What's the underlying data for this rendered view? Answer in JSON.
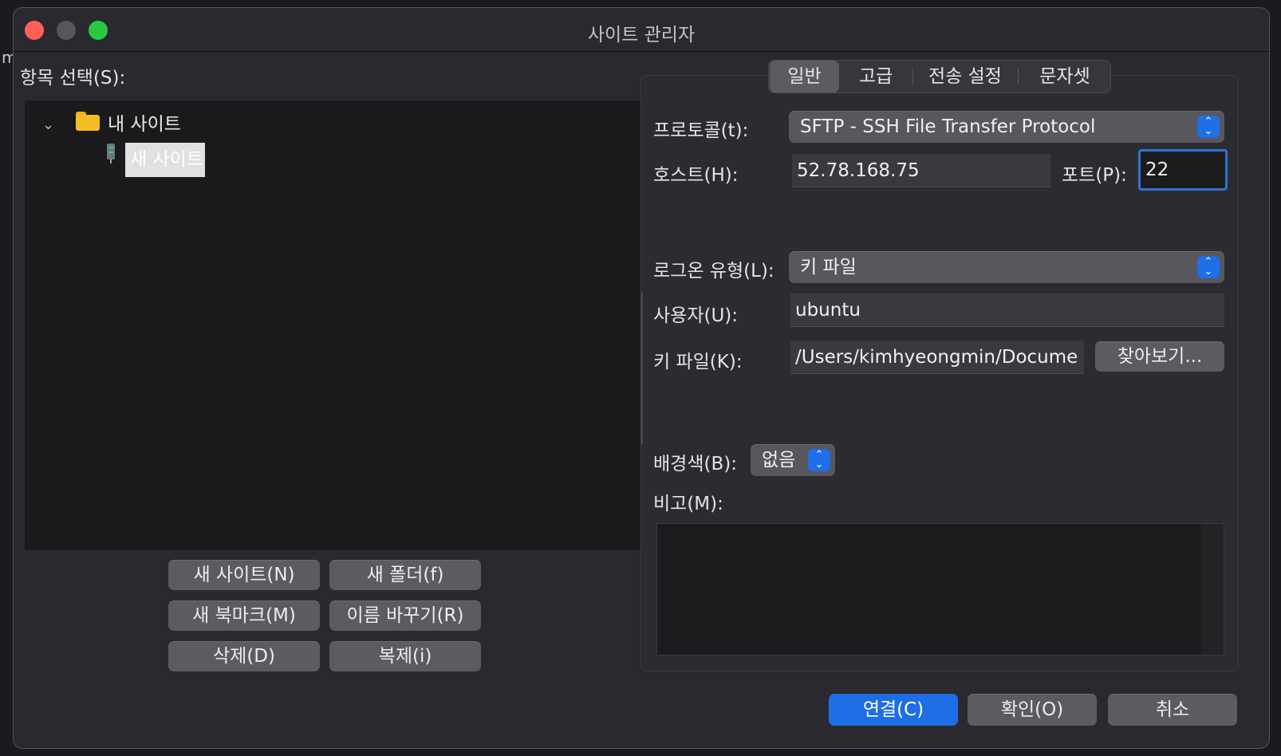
{
  "window": {
    "title": "사이트 관리자"
  },
  "left": {
    "select_label": "항목 선택(S):",
    "tree": {
      "folder": "내 사이트",
      "site": "새 사이트"
    },
    "buttons": {
      "new_site": "새 사이트(N)",
      "new_folder": "새 폴더(f)",
      "new_bookmark": "새 북마크(M)",
      "rename": "이름 바꾸기(R)",
      "delete": "삭제(D)",
      "duplicate": "복제(i)"
    }
  },
  "tabs": [
    "일반",
    "고급",
    "전송 설정",
    "문자셋"
  ],
  "general": {
    "protocol_label": "프로토콜(t):",
    "protocol_value": "SFTP - SSH File Transfer Protocol",
    "host_label": "호스트(H):",
    "host_value": "52.78.168.75",
    "port_label": "포트(P):",
    "port_value": "22",
    "logon_label": "로그온 유형(L):",
    "logon_value": "키 파일",
    "user_label": "사용자(U):",
    "user_value": "ubuntu",
    "keyfile_label": "키 파일(K):",
    "keyfile_value": "/Users/kimhyeongmin/Docume",
    "browse_button": "찾아보기...",
    "bgcolor_label": "배경색(B):",
    "bgcolor_value": "없음",
    "comment_label": "비고(M):"
  },
  "footer": {
    "connect": "연결(C)",
    "ok": "확인(O)",
    "cancel": "취소"
  },
  "colors": {
    "accent": "#1e6ee6",
    "close": "#fe5f57",
    "zoom": "#28c840",
    "folder": "#f6bd22"
  }
}
